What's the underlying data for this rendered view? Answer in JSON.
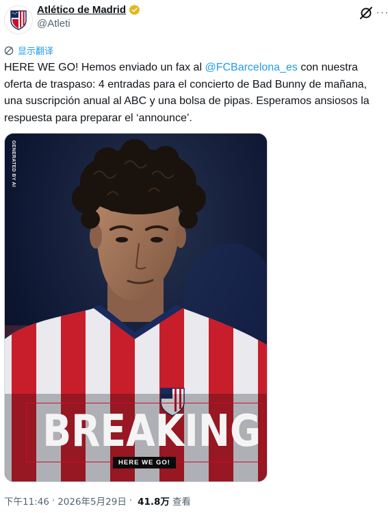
{
  "header": {
    "display_name": "Atlético de Madrid",
    "handle": "@Atleti",
    "verified_color": "#e2b719",
    "grok_icon": "grok-icon",
    "more_icon": "more-icon",
    "more_label": "···"
  },
  "translate": {
    "label": "显示翻译",
    "icon": "translate-icon"
  },
  "tweet": {
    "text_before": "HERE WE GO! Hemos enviado un fax al ",
    "mention": "@FCBarcelona_es",
    "text_after": " con nuestra oferta de traspaso: 4 entradas para el concierto de Bad Bunny de mañana, una suscripción anual al ABC y una bolsa de pipas. Esperamos ansiosos la respuesta para preparar el ‘announce’."
  },
  "media": {
    "ai_tag": "GENERATED BY AI",
    "headline": "BREAKING",
    "subheadline": "HERE WE GO!",
    "accent_color": "#c8102e"
  },
  "meta": {
    "time": "下午11:46",
    "separator": "·",
    "date": "2026年5月29日",
    "views_count": "41.8万",
    "views_label": "查看"
  }
}
